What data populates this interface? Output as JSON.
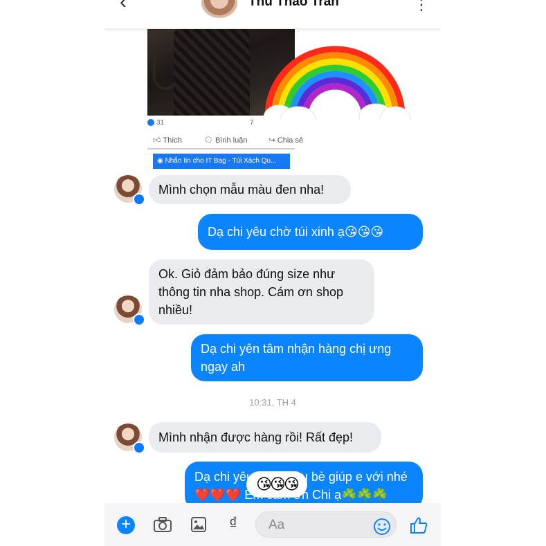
{
  "header": {
    "contact_name": "Thu Thảo Trần"
  },
  "shared_post": {
    "like_count": "31",
    "second_count": "7",
    "actions": [
      "Thích",
      "Bình luận",
      "Chia sẻ"
    ],
    "cta": "Nhắn tin cho IT Bag - Túi Xách Qu..."
  },
  "messages": [
    {
      "side": "in",
      "text": "Mình chọn mẫu màu đen nha!"
    },
    {
      "side": "out",
      "text": "Dạ chi yêu chờ túi xinh ạ😘😘😘"
    },
    {
      "side": "in",
      "text": "Ok. Giỏ đảm bảo đúng size như thông tin nha shop. Cám ơn shop nhiều!"
    },
    {
      "side": "out",
      "text": "Dạ chi yên tâm nhận hàng chị ưng ngay ah"
    },
    {
      "side": "in",
      "text": "Mình nhận được hàng rồi! Rất đẹp!"
    },
    {
      "side": "out",
      "text": "Dạ chi yêu giới thiệu bè giúp e với nhé ❤️❤️❤️ Em cảm ơn Chi ạ☘️☘️☘️"
    }
  ],
  "timestamp": "10:31, TH 4",
  "sticker": "😘😘😘",
  "composer": {
    "placeholder": "Aa",
    "currency_symbol": "₫"
  },
  "colors": {
    "accent": "#0a84ff",
    "incoming_bubble": "#eaebee"
  }
}
